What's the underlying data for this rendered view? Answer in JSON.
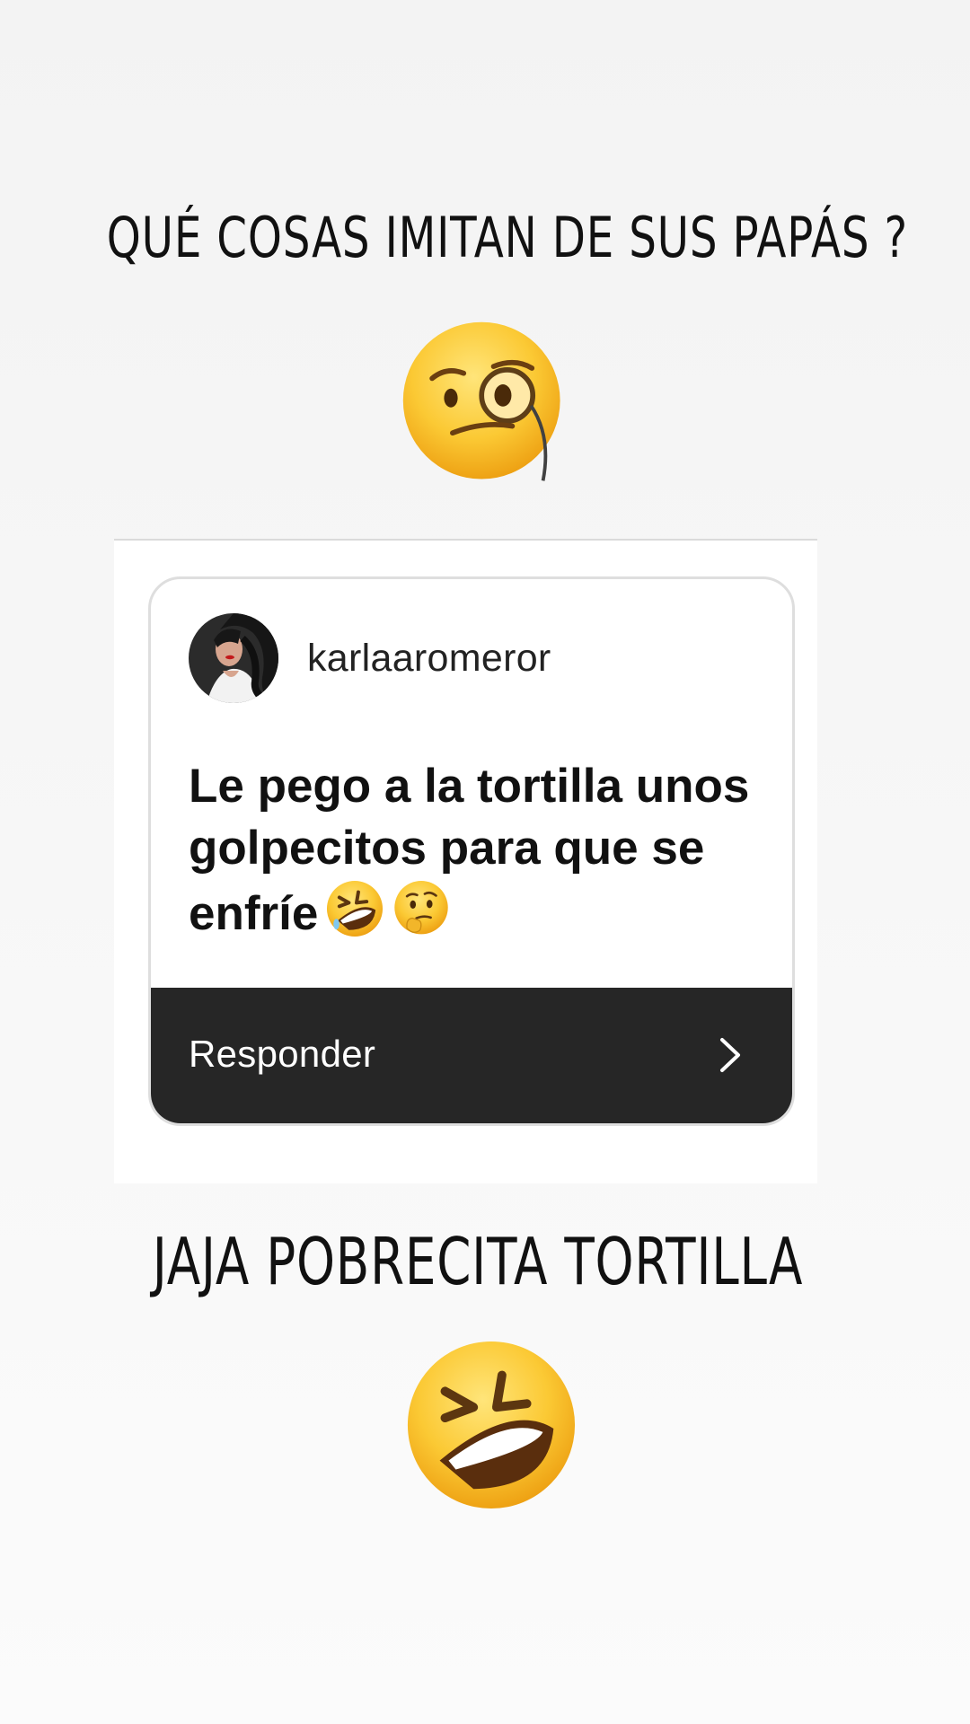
{
  "story": {
    "top_heading": "QUÉ COSAS IMITAN DE SUS PAPÁS ?",
    "bottom_heading": "JAJA POBRECITA TORTILLA"
  },
  "emojis": {
    "top": "face-with-monocle",
    "bottom": "rolling-on-the-floor-laughing"
  },
  "question_card": {
    "username": "karlaaromeror",
    "answer": "Le pego a la tortilla unos golpecitos para que se enfríe",
    "inline_emojis": [
      "rolling-on-the-floor-laughing",
      "thinking-face"
    ],
    "reply_label": "Responder"
  },
  "colors": {
    "background": "#f5f5f5",
    "card_background": "#ffffff",
    "reply_bar": "#262626",
    "emoji_yellow": "#f7c531"
  }
}
